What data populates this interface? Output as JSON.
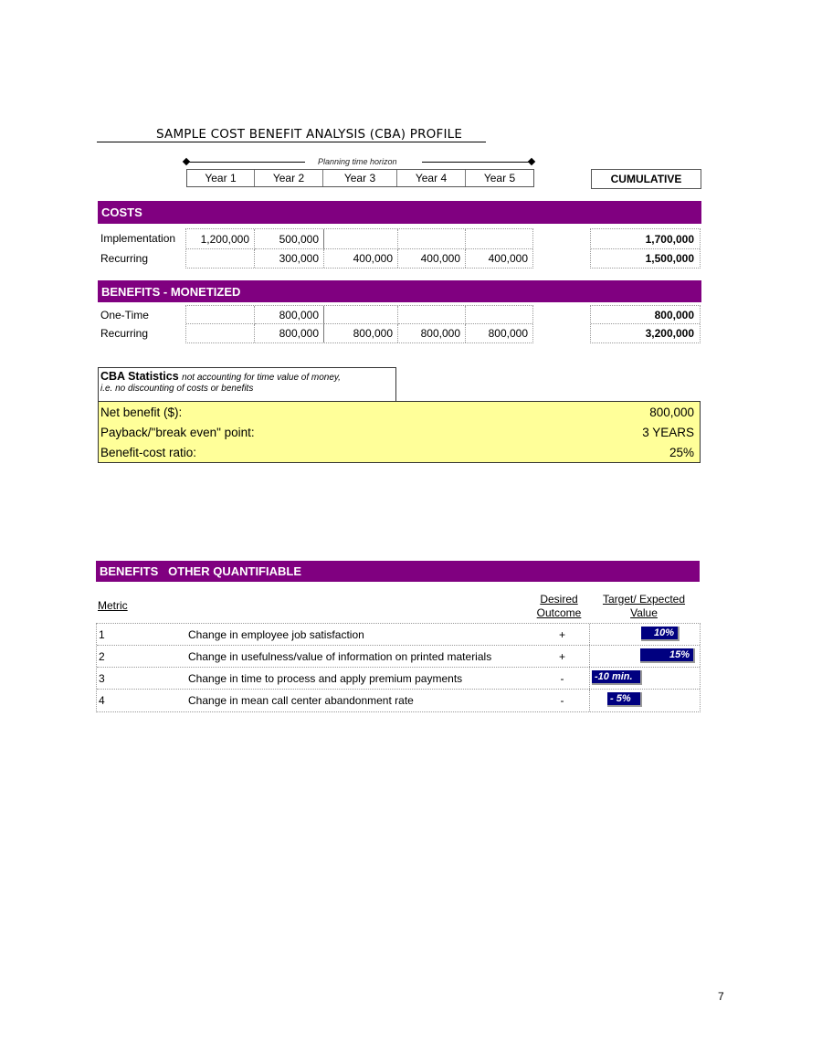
{
  "document": {
    "title": "SAMPLE COST BENEFIT ANALYSIS (CBA) PROFILE",
    "planning_label": "Planning time horizon",
    "years": [
      "Year 1",
      "Year 2",
      "Year 3",
      "Year 4",
      "Year 5"
    ],
    "cumulative_label": "CUMULATIVE",
    "page_number": "7"
  },
  "costs": {
    "header": "COSTS",
    "rows": [
      {
        "label": "Implementation",
        "values": [
          "1,200,000",
          "500,000",
          "",
          "",
          ""
        ],
        "cumulative": "1,700,000"
      },
      {
        "label": "Recurring",
        "values": [
          "",
          "300,000",
          "400,000",
          "400,000",
          "400,000"
        ],
        "cumulative": "1,500,000"
      }
    ]
  },
  "benefits_monetized": {
    "header": "BENEFITS - MONETIZED",
    "rows": [
      {
        "label": "One-Time",
        "values": [
          "",
          "800,000",
          "",
          "",
          ""
        ],
        "cumulative": "800,000"
      },
      {
        "label": "Recurring",
        "values": [
          "",
          "800,000",
          "800,000",
          "800,000",
          "800,000"
        ],
        "cumulative": "3,200,000"
      }
    ]
  },
  "cba_statistics": {
    "title": "CBA Statistics",
    "note_line1": "not accounting for time value of money,",
    "note_line2": "i.e. no discounting of costs or benefits",
    "rows": [
      {
        "label": "Net benefit ($):",
        "value": "800,000"
      },
      {
        "label": "Payback/\"break even\" point:",
        "value": "3 YEARS"
      },
      {
        "label": "Benefit-cost ratio:",
        "value": "25%"
      }
    ]
  },
  "other_quantifiable": {
    "header": "BENEFITS   OTHER QUANTIFIABLE",
    "col_metric": "Metric",
    "col_outcome_1": "Desired",
    "col_outcome_2": "Outcome",
    "col_value_1": "Target/ Expected",
    "col_value_2": "Value",
    "rows": [
      {
        "num": "1",
        "desc": "Change in employee job satisfaction",
        "outcome": "+",
        "value": "10%"
      },
      {
        "num": "2",
        "desc": "Change in usefulness/value of information on printed materials",
        "outcome": "+",
        "value": "15%"
      },
      {
        "num": "3",
        "desc": "Change in time to process and apply premium payments",
        "outcome": "-",
        "value": "-10 min."
      },
      {
        "num": "4",
        "desc": "Change in mean call center abandonment rate",
        "outcome": "-",
        "value": "- 5%"
      }
    ],
    "bar_color": "#000080"
  },
  "colors": {
    "section_bar": "#800080",
    "stats_fill": "#ffff99"
  }
}
